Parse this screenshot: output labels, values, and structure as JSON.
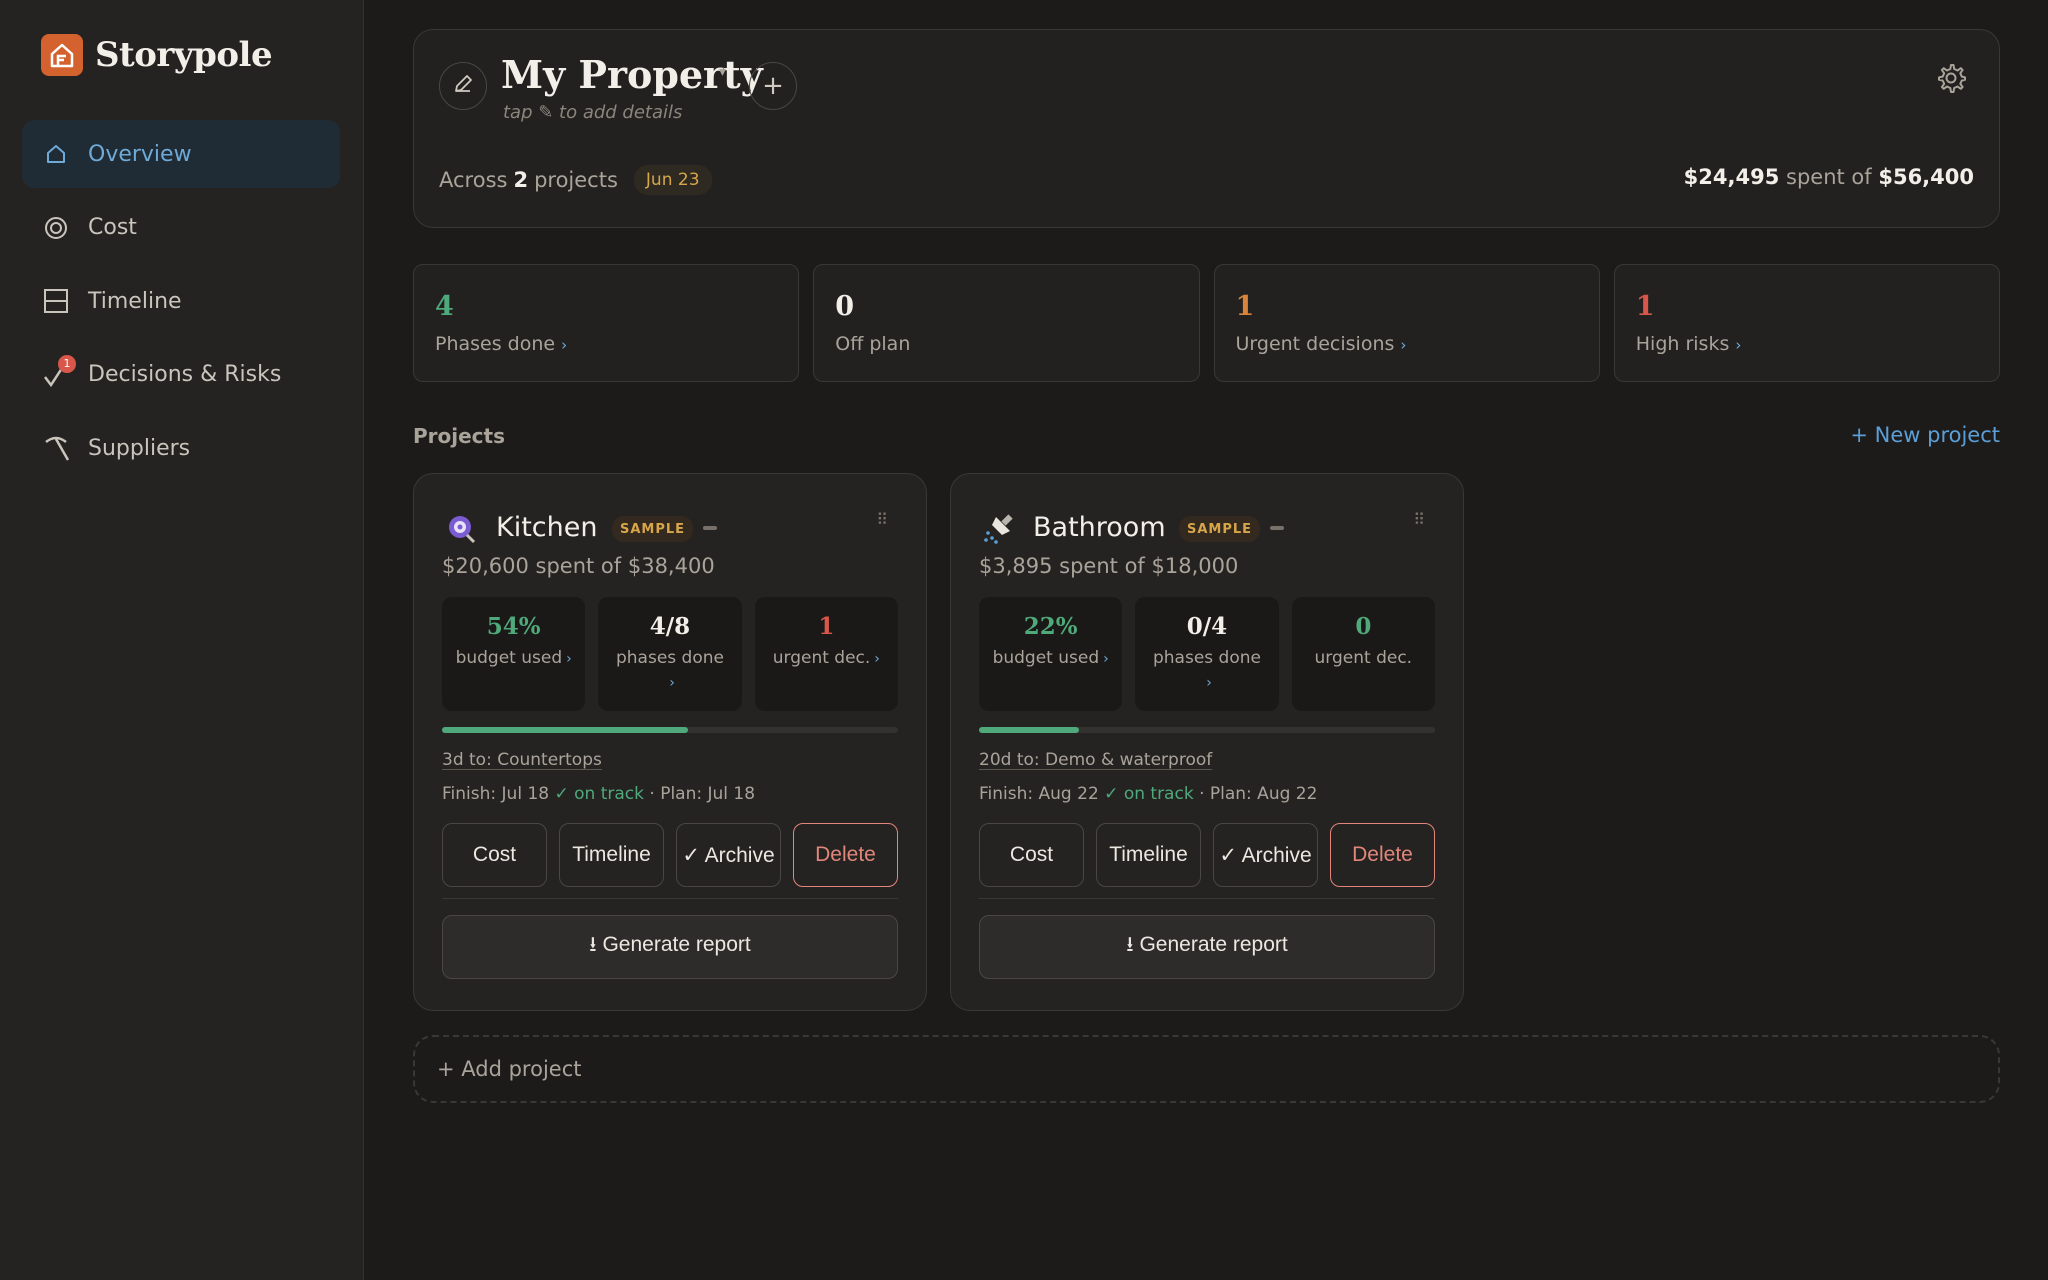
{
  "brand": {
    "name": "Storypole",
    "icon": "house-logo-icon"
  },
  "sidebar": {
    "items": [
      {
        "label": "Overview",
        "icon": "home-icon",
        "active": true
      },
      {
        "label": "Cost",
        "icon": "target-icon"
      },
      {
        "label": "Timeline",
        "icon": "timeline-icon"
      },
      {
        "label": "Decisions & Risks",
        "icon": "check-icon",
        "badge": "1"
      },
      {
        "label": "Suppliers",
        "icon": "pickaxe-icon"
      }
    ]
  },
  "header": {
    "title": "My Property",
    "caret": "▾",
    "subtitle": "tap ✎ to add details",
    "add_symbol": "+",
    "across_prefix": "Across",
    "across_count": "2",
    "across_suffix": "projects",
    "date_badge": "Jun 23",
    "spent_amount": "$24,495",
    "spent_of": "spent of",
    "budget_total": "$56,400"
  },
  "stats": [
    {
      "value": "4",
      "label": "Phases done",
      "color": "#4fa97a",
      "chevron": "›"
    },
    {
      "value": "0",
      "label": "Off plan",
      "color": "#f2efe9",
      "chevron": ""
    },
    {
      "value": "1",
      "label": "Urgent decisions",
      "color": "#d8843a",
      "chevron": "›"
    },
    {
      "value": "1",
      "label": "High risks",
      "color": "#d9564a",
      "chevron": "›"
    }
  ],
  "projects_section": {
    "heading": "Projects",
    "new_project": "+ New project",
    "add_project": "+ Add project"
  },
  "projects": [
    {
      "name": "Kitchen",
      "icon": "mixer-icon",
      "badge": "SAMPLE",
      "spent": "$20,600 spent of $38,400",
      "budget_pct": "54%",
      "budget_label": "budget used",
      "phases": "4/8",
      "phases_label": "phases done",
      "urgent": "1",
      "urgent_label": "urgent dec.",
      "urgent_color": "#d9564a",
      "progress": 0.54,
      "next": "3d to: Countertops",
      "finish_prefix": "Finish: Jul 18",
      "on_track": "✓ on track",
      "plan": "· Plan: Jul 18",
      "buttons": {
        "cost": "Cost",
        "timeline": "Timeline",
        "archive": "✓ Archive",
        "delete": "Delete"
      },
      "report": "⭳ Generate report"
    },
    {
      "name": "Bathroom",
      "icon": "shower-icon",
      "badge": "SAMPLE",
      "spent": "$3,895 spent of $18,000",
      "budget_pct": "22%",
      "budget_label": "budget used",
      "phases": "0/4",
      "phases_label": "phases done",
      "urgent": "0",
      "urgent_label": "urgent dec.",
      "urgent_color": "#4fa97a",
      "progress": 0.22,
      "next": "20d to: Demo & waterproof",
      "finish_prefix": "Finish: Aug 22",
      "on_track": "✓ on track",
      "plan": "· Plan: Aug 22",
      "buttons": {
        "cost": "Cost",
        "timeline": "Timeline",
        "archive": "✓ Archive",
        "delete": "Delete"
      },
      "report": "⭳ Generate report"
    }
  ],
  "colors": {
    "accent": "#5b9fd6",
    "brand": "#d4622f",
    "positive": "#4fa97a",
    "warning": "#d8a64a",
    "danger": "#d9564a"
  }
}
